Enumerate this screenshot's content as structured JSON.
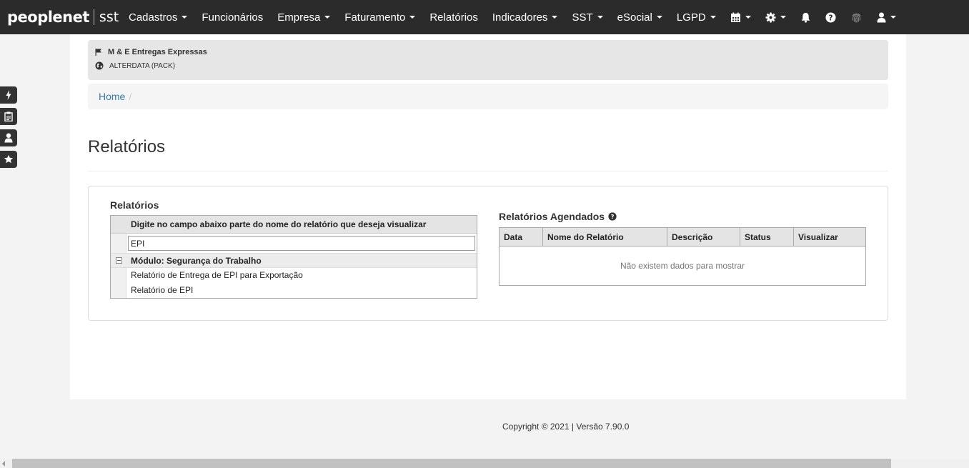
{
  "brand": {
    "logo": "peoplenet",
    "product": "sst"
  },
  "nav": {
    "items": [
      {
        "label": "Cadastros",
        "dropdown": true
      },
      {
        "label": "Funcionários",
        "dropdown": false
      },
      {
        "label": "Empresa",
        "dropdown": true
      },
      {
        "label": "Faturamento",
        "dropdown": true
      },
      {
        "label": "Relatórios",
        "dropdown": false
      },
      {
        "label": "Indicadores",
        "dropdown": true
      },
      {
        "label": "SST",
        "dropdown": true
      },
      {
        "label": "eSocial",
        "dropdown": true
      },
      {
        "label": "LGPD",
        "dropdown": true
      }
    ],
    "icons": [
      "calendar-icon",
      "gear-icon",
      "bell-icon",
      "question-circle-icon",
      "fingerprint-icon",
      "user-icon"
    ]
  },
  "side_tabs": [
    "bolt-icon",
    "clipboard-icon",
    "user-icon",
    "star-icon"
  ],
  "company": {
    "name": "M & E Entregas Expressas",
    "group": "ALTERDATA (PACK)"
  },
  "breadcrumb": {
    "home": "Home"
  },
  "page": {
    "title": "Relatórios"
  },
  "reports": {
    "heading": "Relatórios",
    "instruction": "Digite no campo abaixo parte do nome do relatório que deseja visualizar",
    "search_value": "EPI",
    "group": "Módulo: Segurança do Trabalho",
    "items": [
      "Relatório de Entrega de EPI para Exportação",
      "Relatório de EPI"
    ]
  },
  "scheduled": {
    "heading": "Relatórios Agendados",
    "columns": [
      "Data",
      "Nome do Relatório",
      "Descrição",
      "Status",
      "Visualizar"
    ],
    "empty_text": "Não existem dados para mostrar"
  },
  "footer": {
    "text": "Copyright © 2021 | Versão 7.90.0"
  },
  "colors": {
    "navbar": "#2b2b2b",
    "link": "#337ab7"
  }
}
